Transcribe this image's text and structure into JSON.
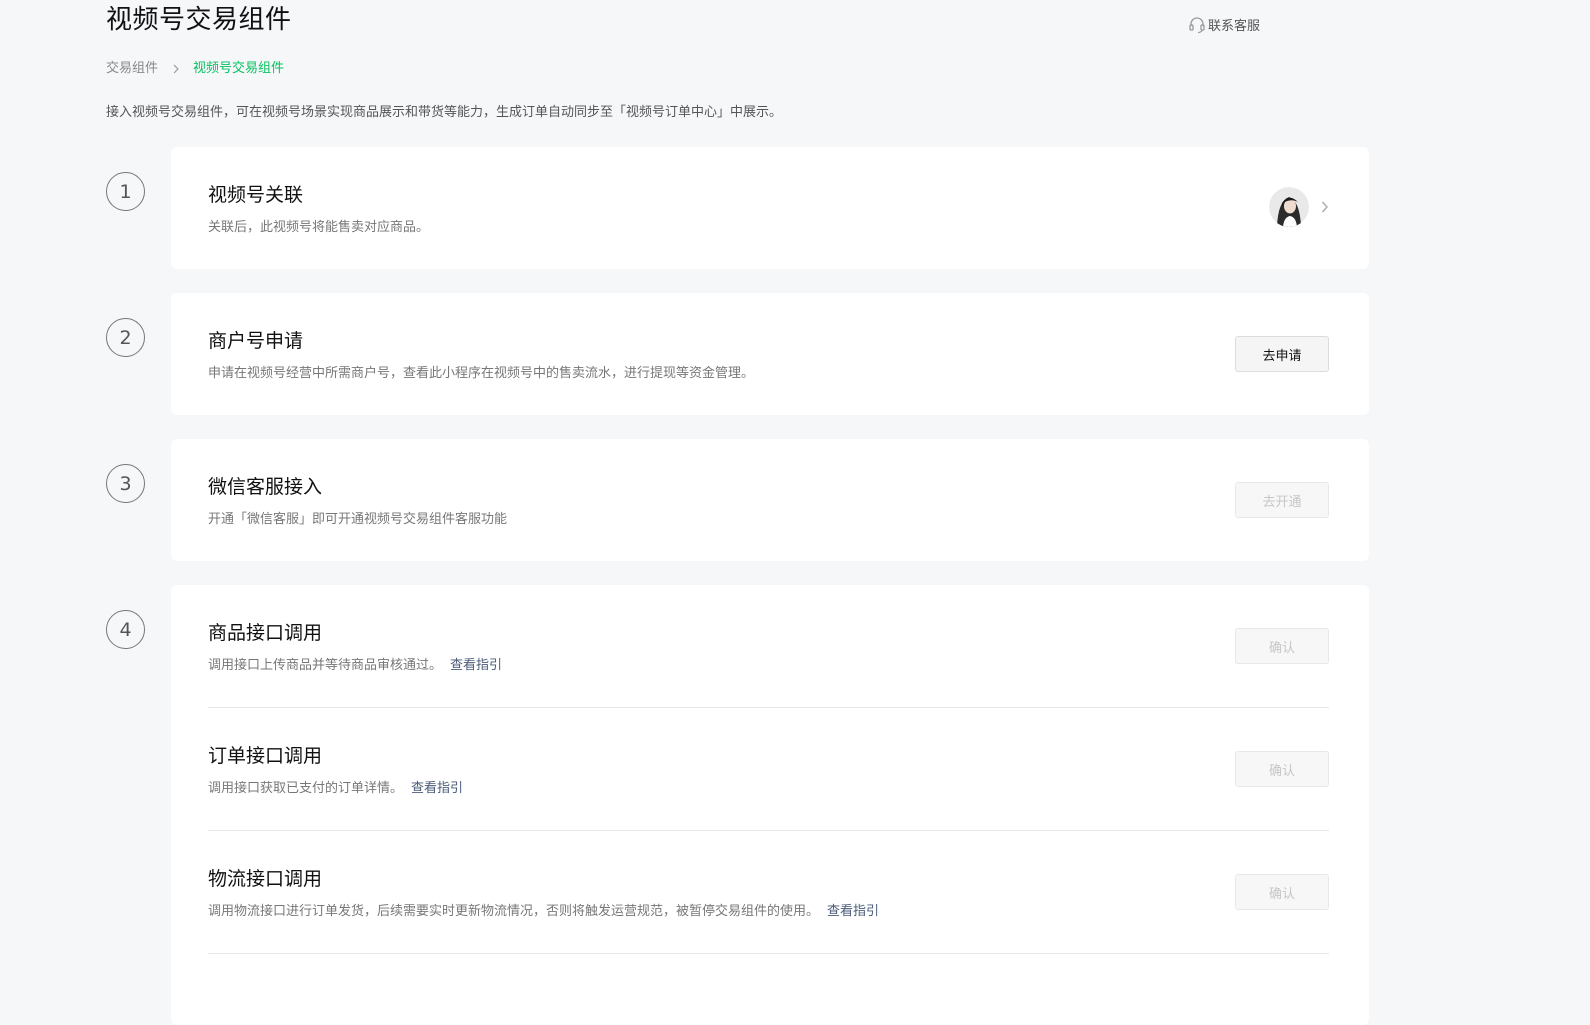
{
  "header": {
    "title": "视频号交易组件",
    "support_label": "联系客服"
  },
  "breadcrumb": {
    "root": "交易组件",
    "current": "视频号交易组件"
  },
  "intro": "接入视频号交易组件，可在视频号场景实现商品展示和带货等能力，生成订单自动同步至「视频号订单中心」中展示。",
  "steps": [
    {
      "number": "1",
      "title": "视频号关联",
      "desc": "关联后，此视频号将能售卖对应商品。"
    },
    {
      "number": "2",
      "title": "商户号申请",
      "desc": "申请在视频号经营中所需商户号，查看此小程序在视频号中的售卖流水，进行提现等资金管理。",
      "button": "去申请"
    },
    {
      "number": "3",
      "title": "微信客服接入",
      "desc": "开通「微信客服」即可开通视频号交易组件客服功能",
      "button": "去开通"
    },
    {
      "number": "4",
      "items": [
        {
          "title": "商品接口调用",
          "desc": "调用接口上传商品并等待商品审核通过。",
          "link": "查看指引",
          "button": "确认"
        },
        {
          "title": "订单接口调用",
          "desc": "调用接口获取已支付的订单详情。",
          "link": "查看指引",
          "button": "确认"
        },
        {
          "title": "物流接口调用",
          "desc": "调用物流接口进行订单发货，后续需要实时更新物流情况，否则将触发运营规范，被暂停交易组件的使用。",
          "link": "查看指引",
          "button": "确认"
        }
      ]
    }
  ],
  "icons": {
    "support": "headset-icon",
    "breadcrumb_separator": "chevron-right-icon",
    "avatar_chevron": "chevron-right-icon"
  },
  "colors": {
    "accent": "#07c160",
    "link": "#4a5a78",
    "background": "#f6f7f9"
  }
}
